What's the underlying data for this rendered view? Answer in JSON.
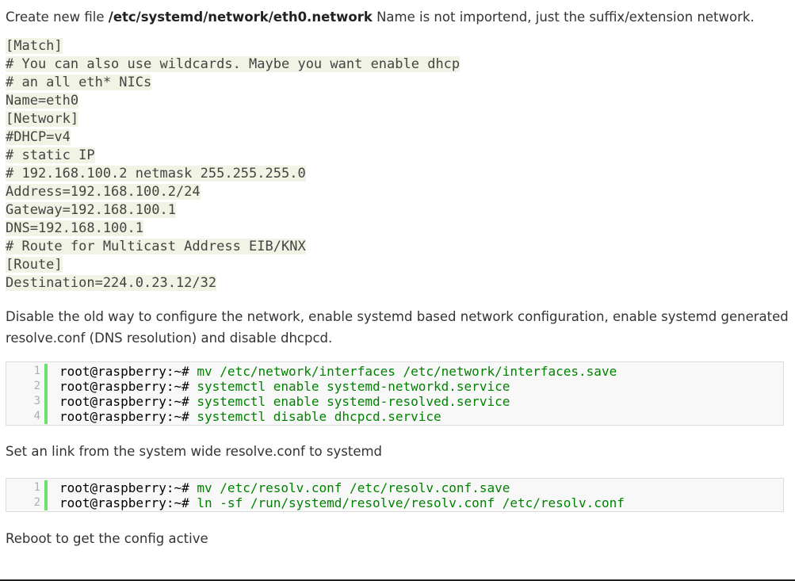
{
  "intro": {
    "text_before": "Create new file ",
    "path": "/etc/systemd/network/eth0.network",
    "text_after": " Name is not importend, just the suffix/extension network."
  },
  "config_lines": [
    "[Match]",
    "# You can also use wildcards. Maybe you want enable dhcp",
    "# an all eth* NICs",
    "Name=eth0",
    "[Network]",
    "#DHCP=v4",
    "# static IP",
    "# 192.168.100.2 netmask 255.255.255.0",
    "Address=192.168.100.2/24",
    "Gateway=192.168.100.1",
    "DNS=192.168.100.1",
    "# Route for Multicast Address EIB/KNX",
    "[Route]",
    "Destination=224.0.23.12/32"
  ],
  "para2": "Disable the old way to configure the network, enable systemd based network configuration, enable systemd generated resolve.conf (DNS resolution) and disable dhcpcd.",
  "code_block_1": [
    {
      "num": "1",
      "prompt": "root@raspberry:~#",
      "cmd": " mv /etc/network/interfaces /etc/network/interfaces.save"
    },
    {
      "num": "2",
      "prompt": "root@raspberry:~#",
      "cmd": " systemctl enable systemd-networkd.service"
    },
    {
      "num": "3",
      "prompt": "root@raspberry:~#",
      "cmd": " systemctl enable systemd-resolved.service"
    },
    {
      "num": "4",
      "prompt": "root@raspberry:~#",
      "cmd": " systemctl disable dhcpcd.service"
    }
  ],
  "para3": "Set an link from the system wide resolve.conf to systemd",
  "code_block_2": [
    {
      "num": "1",
      "prompt": "root@raspberry:~#",
      "cmd": " mv /etc/resolv.conf /etc/resolv.conf.save"
    },
    {
      "num": "2",
      "prompt": "root@raspberry:~#",
      "cmd": " ln -sf /run/systemd/resolve/resolv.conf /etc/resolv.conf"
    }
  ],
  "para4": "Reboot to get the config active",
  "colors": {
    "config_highlight": "#f1f3e4",
    "gutter_bar": "#6ce26c",
    "command_text": "#008200"
  }
}
